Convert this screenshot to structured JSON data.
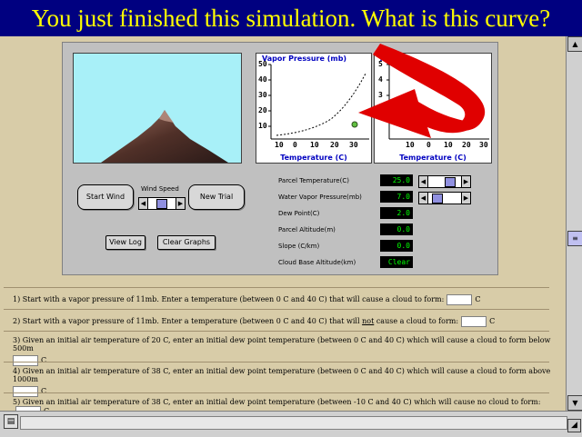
{
  "banner": {
    "text": "You just finished this simulation. What is this curve?"
  },
  "simulation": {
    "graph1": {
      "title": "Vapor Pressure (mb)",
      "xlabel": "Temperature (C)",
      "y_ticks": [
        "50",
        "40",
        "30",
        "20",
        "10"
      ],
      "x_ticks": [
        "10",
        "0",
        "10",
        "20",
        "30"
      ]
    },
    "graph2": {
      "title": "Alt",
      "xlabel": "Temperature (C)",
      "y_ticks": [
        "5",
        "4",
        "3"
      ],
      "x_ticks": [
        "10",
        "0",
        "10",
        "20",
        "30"
      ]
    },
    "buttons": {
      "start_wind": "Start Wind",
      "new_trial": "New Trial",
      "view_log": "View Log",
      "clear_graphs": "Clear Graphs"
    },
    "wind_speed_label": "Wind Speed",
    "params": [
      {
        "label": "Parcel Temperature(C)",
        "value": "25.0"
      },
      {
        "label": "Water Vapor Pressure(mb)",
        "value": "7.0"
      },
      {
        "label": "Dew Point(C)",
        "value": "2.0"
      },
      {
        "label": "Parcel Altitude(m)",
        "value": "0.0"
      },
      {
        "label": "Slope (C/km)",
        "value": "0.0"
      },
      {
        "label": "Cloud Base Altitude(km)",
        "value": "Clear"
      }
    ],
    "slider_levels": {
      "wind_speed": 0.5,
      "parcel_temperature": 0.75,
      "water_vapor_pressure": 0.15
    }
  },
  "questions": [
    {
      "text": "1) Start with a vapor pressure of 11mb. Enter a temperature (between 0 C and 40 C) that will cause a cloud to form:",
      "unit": "C"
    },
    {
      "text_before": "2) Start with a vapor pressure of 11mb. Enter a temperature (between 0 C and 40 C) that will",
      "emphasis": "not",
      "text_after": "cause a cloud to form:",
      "unit": "C"
    },
    {
      "line1": "3) Given an initial air temperature of 20 C, enter an initial dew point temperature (between 0 C and 40 C) which will cause a cloud to form below 500m",
      "unit": "C"
    },
    {
      "line1": "4) Given an initial air temperature of 38 C, enter an initial dew point temperature (between 0 C and 40 C) which will cause a cloud to form above 1000m",
      "unit": "C"
    },
    {
      "text": "5) Given an initial air temperature of 38 C, enter an initial dew point temperature (between -10 C and 40 C) which will cause no cloud to form:",
      "unit": "C"
    }
  ],
  "colors": {
    "banner_bg": "#000080",
    "banner_text": "#ffff00",
    "page_bg": "#d8cca8",
    "panel_bg": "#c0c0c0",
    "arrow": "#e00000",
    "lcd_text": "#00ff00"
  },
  "icons": {
    "scroll_up": "up-arrow-icon",
    "scroll_down": "down-arrow-icon",
    "scroll_thumb": "scroll-thumb-icon",
    "page": "page-icon",
    "resize": "resize-grip-icon"
  }
}
